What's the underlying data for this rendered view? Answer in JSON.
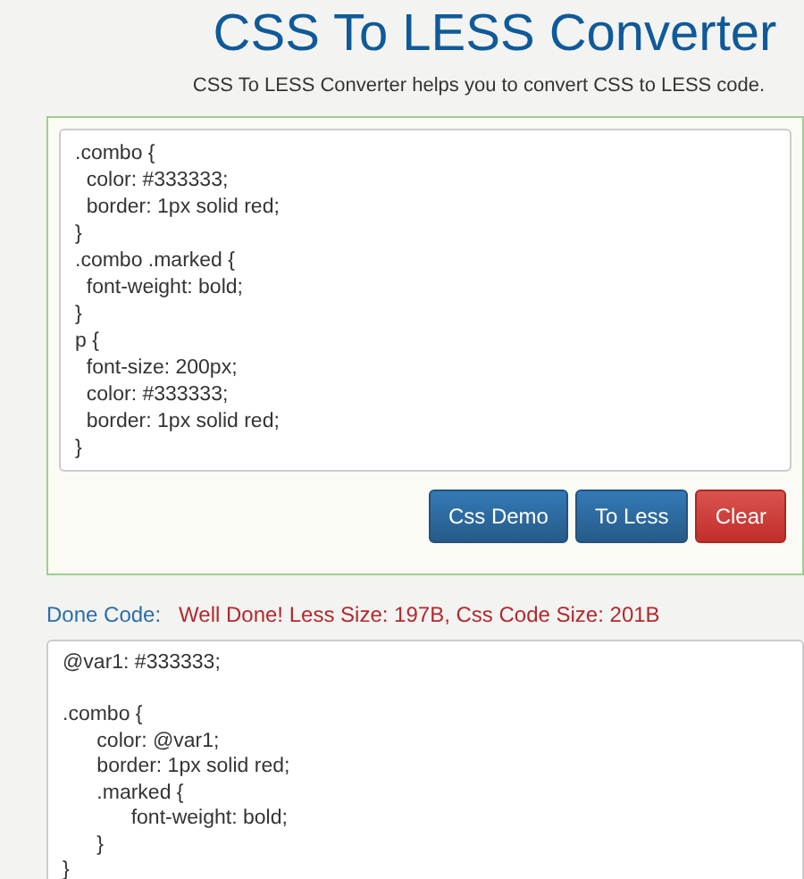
{
  "title": "CSS To LESS Converter",
  "subtitle": "CSS To LESS Converter helps you to convert CSS to LESS code.",
  "input_code": [
    ".combo {",
    "  color: #333333;",
    "  border: 1px solid red;",
    "}",
    ".combo .marked {",
    "  font-weight: bold;",
    "}",
    "p {",
    "  font-size: 200px;",
    "  color: #333333;",
    "  border: 1px solid red;",
    "}"
  ],
  "buttons": [
    {
      "label": "Css Demo",
      "kind": "primary"
    },
    {
      "label": "To Less",
      "kind": "primary"
    },
    {
      "label": "Clear",
      "kind": "danger"
    }
  ],
  "result_label": "Done Code:",
  "result_message": "Well Done! Less Size: 197B, Css Code Size: 201B",
  "output_code": [
    [
      "@var1: #333333;"
    ],
    [
      ".combo {",
      "\tcolor: @var1;",
      "\tborder: 1px solid red;",
      "\t.marked {",
      "\t\tfont-weight: bold;",
      "\t}",
      "}"
    ]
  ]
}
